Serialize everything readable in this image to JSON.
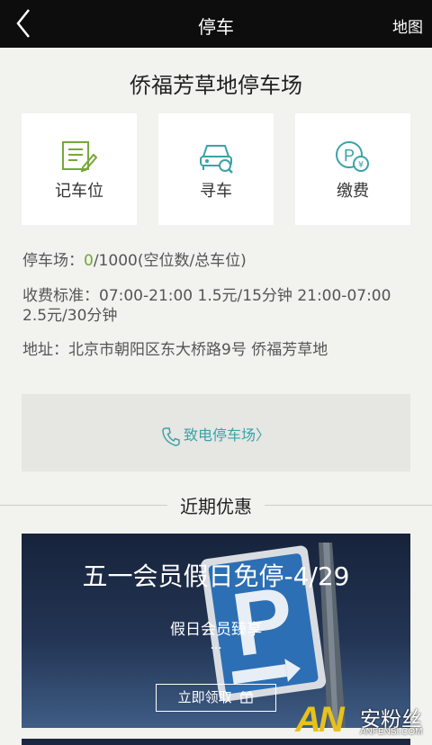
{
  "header": {
    "title": "停车",
    "map_label": "地图"
  },
  "lot": {
    "name": "侨福芳草地停车场"
  },
  "actions": [
    {
      "label": "记车位",
      "icon": "note-edit-icon"
    },
    {
      "label": "寻车",
      "icon": "car-search-icon"
    },
    {
      "label": "缴费",
      "icon": "parking-pay-icon"
    }
  ],
  "info": {
    "capacity_label": "停车场：",
    "capacity_available": "0",
    "capacity_rest": "/1000(空位数/总车位)",
    "fee_line1": "收费标准：07:00-21:00 1.5元/15分钟 21:00-07:00",
    "fee_line2": "2.5元/30分钟",
    "address": "地址：北京市朝阳区东大桥路9号 侨福芳草地"
  },
  "call": {
    "label": "致电停车场",
    "chevron": "〉"
  },
  "section": {
    "title": "近期优惠"
  },
  "promo": {
    "title": "五一会员假日免停-4/29",
    "subtitle": "假日会员臻享",
    "dots": "...",
    "button_label": "立即领取"
  },
  "watermark": {
    "logo": "AN",
    "cn": "安粉丝",
    "en": "ANFENSI.COM"
  },
  "colors": {
    "accent_green": "#6da833",
    "accent_teal": "#3aa3a6",
    "topbar": "#0d0d0d"
  }
}
